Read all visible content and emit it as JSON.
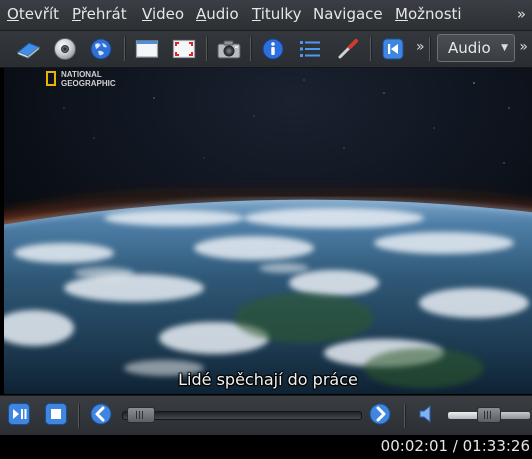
{
  "menubar": {
    "items": [
      {
        "mnemonic": "O",
        "rest": "tevřít"
      },
      {
        "mnemonic": "P",
        "rest": "řehrát"
      },
      {
        "mnemonic": "V",
        "rest": "ideo"
      },
      {
        "mnemonic": "A",
        "rest": "udio"
      },
      {
        "mnemonic": "T",
        "rest": "itulky"
      },
      {
        "mnemonic": "",
        "rest": "Navigace"
      },
      {
        "mnemonic": "M",
        "rest": "ožnosti"
      }
    ],
    "overflow": "»"
  },
  "toolbar": {
    "icons": [
      "open-file-icon",
      "open-disc-icon",
      "open-url-icon",
      "normal-view-icon",
      "fullscreen-icon",
      "screenshot-icon",
      "info-icon",
      "playlist-icon",
      "preferences-icon",
      "back-icon"
    ],
    "overflow": "»",
    "audio_combo": "Audio",
    "overflow2": "»"
  },
  "video": {
    "logo_line1": "NATIONAL",
    "logo_line2": "GEOGRAPHIC",
    "subtitle": "Lidé spěchají do práce"
  },
  "controls": {
    "icons": [
      "play-pause-icon",
      "stop-icon",
      "rewind-icon",
      "forward-icon",
      "volume-icon"
    ],
    "seek_fraction": 0.025,
    "volume_fraction": 0.5
  },
  "status": {
    "time": "00:02:01 / 01:33:26"
  },
  "colors": {
    "accent_blue": "#2f6fd6",
    "logo_yellow": "#e8b400"
  }
}
